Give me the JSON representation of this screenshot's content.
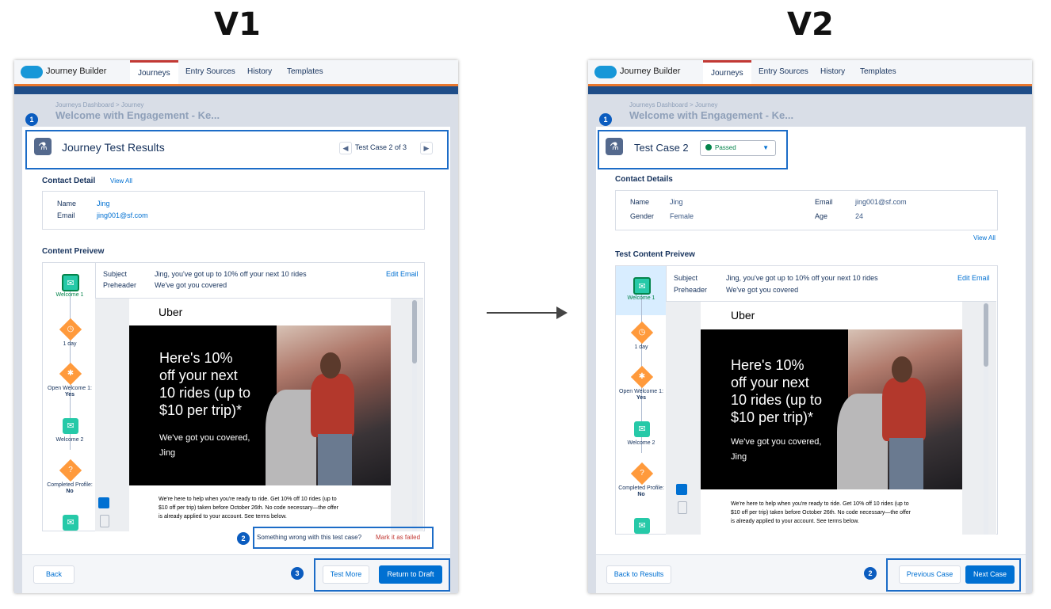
{
  "labels": {
    "v1": "V1",
    "v2": "V2"
  },
  "app": {
    "name": "Journey Builder",
    "tabs": [
      "Journeys",
      "Entry Sources",
      "History",
      "Templates"
    ],
    "breadcrumb": "Journeys Dashboard > Journey",
    "journey_title": "Welcome with Engagement - Ke..."
  },
  "v1": {
    "header_title": "Journey Test Results",
    "pager": "Test Case 2 of 3",
    "contact_heading": "Contact Detail",
    "view_all": "View All",
    "contact": [
      {
        "label": "Name",
        "value": "Jing"
      },
      {
        "label": "Email",
        "value": "jing001@sf.com"
      }
    ],
    "preview_heading": "Content Preivew",
    "wrong_text": "Something wrong with this test case?",
    "mark_failed": "Mark it as failed",
    "back": "Back",
    "test_more": "Test More",
    "return_draft": "Return to Draft",
    "markers": [
      "1",
      "2",
      "3"
    ]
  },
  "v2": {
    "header_title": "Test Case 2",
    "status": "Passed",
    "contact_heading": "Contact Details",
    "contact_left": [
      {
        "label": "Name",
        "value": "Jing"
      },
      {
        "label": "Gender",
        "value": "Female"
      }
    ],
    "contact_right": [
      {
        "label": "Email",
        "value": "jing001@sf.com"
      },
      {
        "label": "Age",
        "value": "24"
      }
    ],
    "view_all": "View All",
    "preview_heading": "Test Content Preivew",
    "back_results": "Back to Results",
    "prev_case": "Previous Case",
    "next_case": "Next Case",
    "markers": [
      "1",
      "2"
    ]
  },
  "journey_nodes": [
    {
      "label": "Welcome 1",
      "type": "email"
    },
    {
      "label": "1 day",
      "type": "wait"
    },
    {
      "label": "Open Welcome 1:",
      "value": "Yes",
      "type": "decision"
    },
    {
      "label": "Welcome 2",
      "type": "email"
    },
    {
      "label": "Completed Profile:",
      "value": "No",
      "type": "question"
    }
  ],
  "email": {
    "subject_label": "Subject",
    "subject": "Jing, you've got up to 10% off your next 10 rides",
    "preheader_label": "Preheader",
    "preheader": "We've got you covered",
    "edit": "Edit Email",
    "brand": "Uber",
    "hero_lines": [
      "Here's 10%",
      "off your next",
      "10 rides (up to",
      "$10 per trip)*"
    ],
    "hero_sub": "We've got you covered,",
    "hero_name": "Jing",
    "body_lines": [
      "We're here to help when you're ready to ride. Get 10% off 10 rides (up to",
      "$10 off per trip) taken before October 26th. No code necessary—the offer",
      "is already applied to your account. See terms below."
    ]
  },
  "colors": {
    "accent": "#0070d2",
    "tab_highlight": "#c23934",
    "orange": "#e8772e",
    "annotation": "#1c6cc7"
  }
}
